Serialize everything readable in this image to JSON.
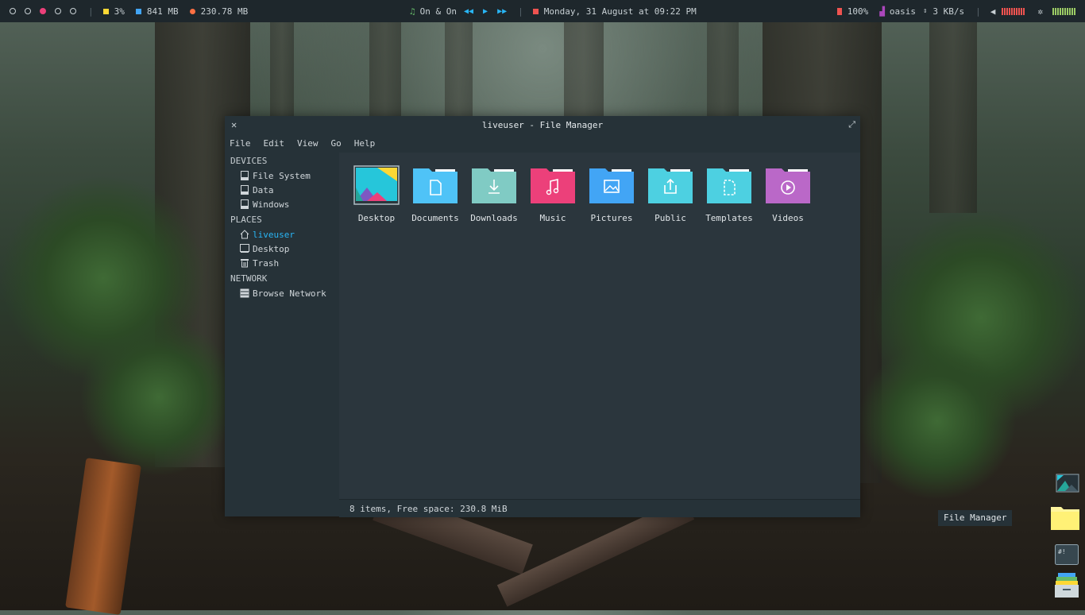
{
  "topbar": {
    "workspaces": [
      "ws1",
      "ws2",
      "ws3",
      "ws4",
      "ws5"
    ],
    "cpu": "3%",
    "memory": "841 MB",
    "storage": "230.78 MB",
    "music": "On & On",
    "date": "Monday, 31 August at 09:22 PM",
    "battery": "100%",
    "network": "oasis",
    "speed": "3 KB/s"
  },
  "window": {
    "title": "liveuser - File Manager",
    "menu": [
      "File",
      "Edit",
      "View",
      "Go",
      "Help"
    ]
  },
  "sidebar": {
    "sections": [
      {
        "title": "DEVICES",
        "items": [
          {
            "label": "File System",
            "icon": "drive-icon"
          },
          {
            "label": "Data",
            "icon": "drive-icon"
          },
          {
            "label": "Windows",
            "icon": "drive-icon"
          }
        ]
      },
      {
        "title": "PLACES",
        "items": [
          {
            "label": "liveuser",
            "icon": "home-icon",
            "active": true
          },
          {
            "label": "Desktop",
            "icon": "desktop-icon"
          },
          {
            "label": "Trash",
            "icon": "trash-icon"
          }
        ]
      },
      {
        "title": "NETWORK",
        "items": [
          {
            "label": "Browse Network",
            "icon": "network-icon"
          }
        ]
      }
    ]
  },
  "files": [
    {
      "name": "Desktop",
      "color": "#26c6da",
      "icon": "desktop-folder-icon"
    },
    {
      "name": "Documents",
      "color": "#4fc3f7",
      "icon": "document-icon"
    },
    {
      "name": "Downloads",
      "color": "#80cbc4",
      "icon": "download-icon"
    },
    {
      "name": "Music",
      "color": "#ec407a",
      "icon": "music-icon"
    },
    {
      "name": "Pictures",
      "color": "#42a5f5",
      "icon": "picture-icon"
    },
    {
      "name": "Public",
      "color": "#4dd0e1",
      "icon": "share-icon"
    },
    {
      "name": "Templates",
      "color": "#4dd0e1",
      "icon": "template-icon"
    },
    {
      "name": "Videos",
      "color": "#ba68c8",
      "icon": "video-icon"
    }
  ],
  "status": "8 items, Free space: 230.8 MiB",
  "dock": {
    "tooltip": "File Manager"
  },
  "colors": {
    "accent": "#29b6f6",
    "active_workspace": "#ec407a"
  }
}
